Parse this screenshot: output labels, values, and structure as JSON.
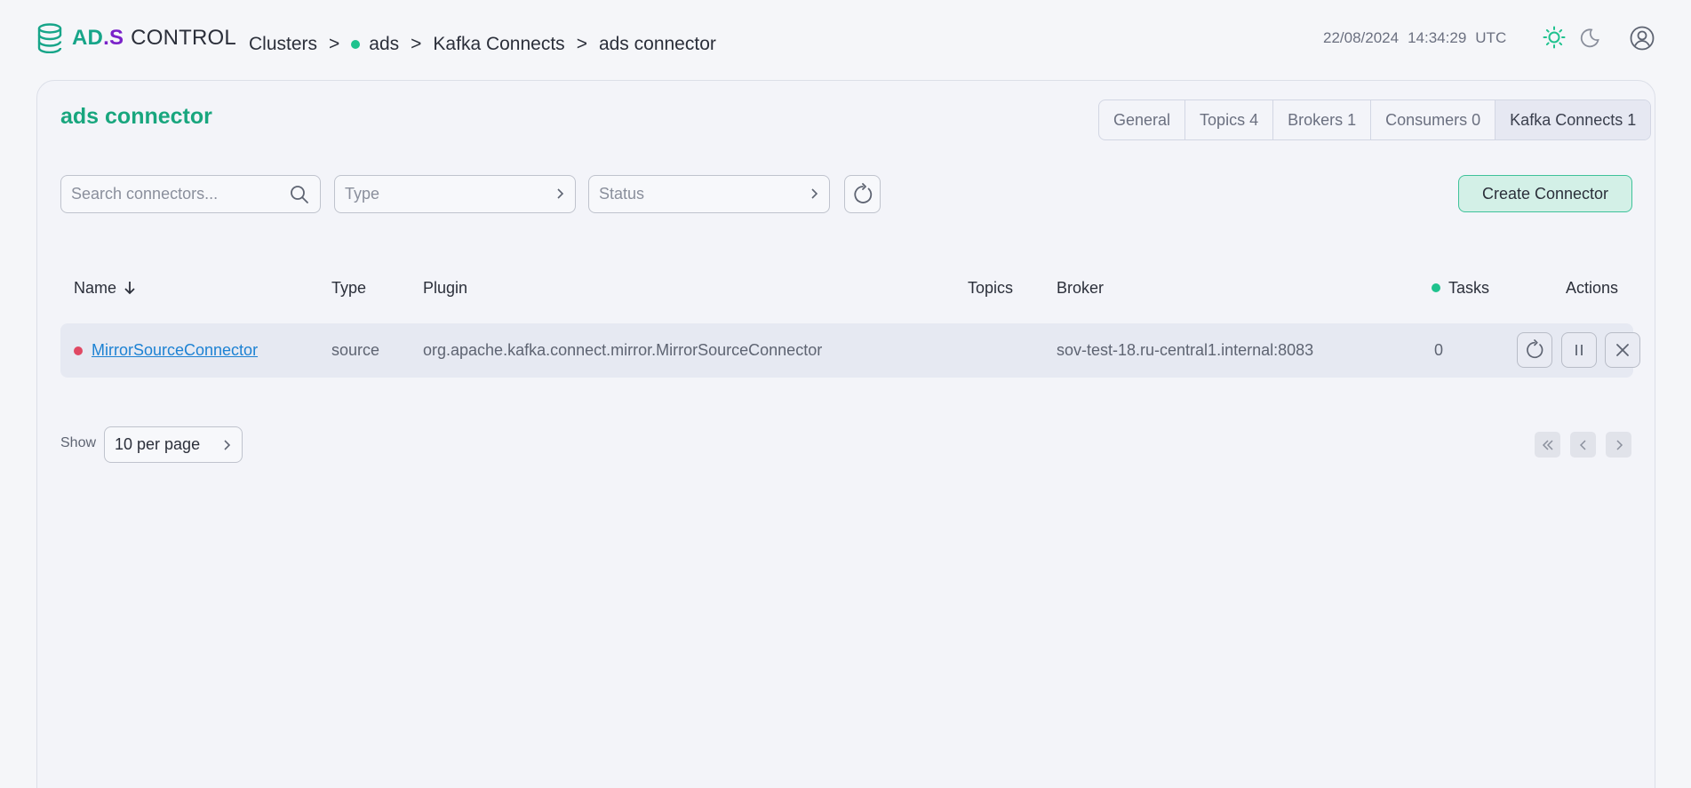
{
  "app": {
    "logo": {
      "ad": "AD",
      "dot": ".",
      "s": "S",
      "control": "CONTROL"
    }
  },
  "breadcrumb": [
    {
      "label": "Clusters"
    },
    {
      "label": "ads",
      "status_color": "#1fc28e"
    },
    {
      "label": "Kafka Connects"
    },
    {
      "label": "ads connector"
    }
  ],
  "breadcrumb_separator": ">",
  "header": {
    "date": "22/08/2024",
    "time": "14:34:29",
    "timezone": "UTC",
    "icons": [
      "sun-icon",
      "moon-icon",
      "user-icon"
    ]
  },
  "page": {
    "title": "ads connector"
  },
  "tabs": [
    {
      "label": "General"
    },
    {
      "label": "Topics 4"
    },
    {
      "label": "Brokers 1"
    },
    {
      "label": "Consumers 0"
    },
    {
      "label": "Kafka Connects 1",
      "active": true
    }
  ],
  "filters": {
    "search_placeholder": "Search connectors...",
    "type_placeholder": "Type",
    "status_placeholder": "Status"
  },
  "create_button": "Create Connector",
  "table": {
    "columns": {
      "name": "Name",
      "type": "Type",
      "plugin": "Plugin",
      "topics": "Topics",
      "broker": "Broker",
      "tasks": "Tasks",
      "actions": "Actions"
    },
    "rows": [
      {
        "name": "MirrorSourceConnector",
        "status_color": "#e04863",
        "type": "source",
        "plugin": "org.apache.kafka.connect.mirror.MirrorSourceConnector",
        "topics": "",
        "broker": "sov-test-18.ru-central1.internal:8083",
        "tasks": "0"
      }
    ]
  },
  "pagination": {
    "show_label": "Show",
    "per_page": "10 per page"
  },
  "colors": {
    "accent": "#18a67e",
    "status_running": "#1fc28e",
    "status_failed": "#e04863",
    "link": "#1d82d3"
  }
}
